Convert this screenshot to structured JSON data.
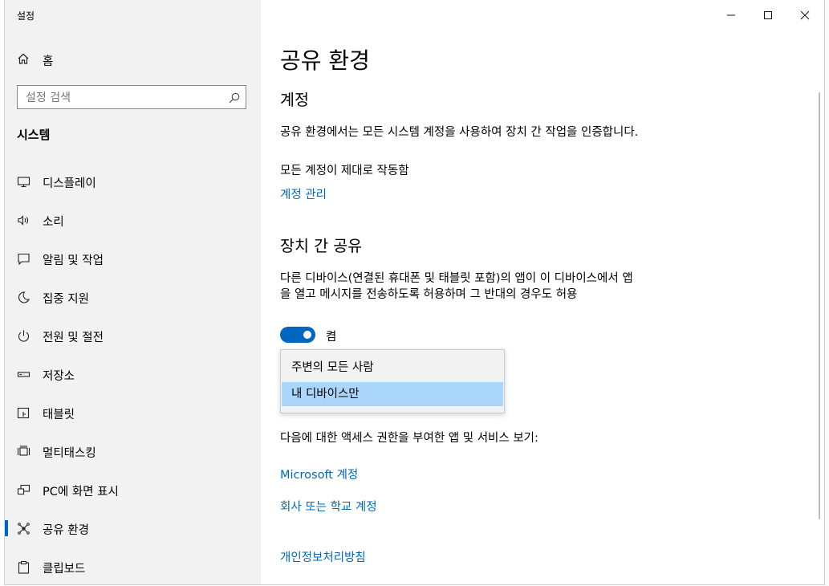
{
  "window": {
    "title": "설정",
    "controls": [
      "minimize",
      "maximize",
      "close"
    ]
  },
  "sidebar": {
    "home_label": "홈",
    "search_placeholder": "설정 검색",
    "section_title": "시스템",
    "items": [
      {
        "label": "디스플레이",
        "icon": "monitor-icon"
      },
      {
        "label": "소리",
        "icon": "speaker-icon"
      },
      {
        "label": "알림 및 작업",
        "icon": "notification-icon"
      },
      {
        "label": "집중 지원",
        "icon": "moon-icon"
      },
      {
        "label": "전원 및 절전",
        "icon": "power-icon"
      },
      {
        "label": "저장소",
        "icon": "storage-icon"
      },
      {
        "label": "태블릿",
        "icon": "tablet-icon"
      },
      {
        "label": "멀티태스킹",
        "icon": "multitasking-icon"
      },
      {
        "label": "PC에 화면 표시",
        "icon": "project-icon"
      },
      {
        "label": "공유 환경",
        "icon": "shared-experiences-icon",
        "active": true
      },
      {
        "label": "클립보드",
        "icon": "clipboard-icon"
      }
    ]
  },
  "main": {
    "page_title": "공유 환경",
    "accounts": {
      "heading": "계정",
      "description": "공유 환경에서는 모든 시스템 계정을 사용하여 장치 간 작업을 인증합니다.",
      "status": "모든 계정이 제대로 작동함",
      "manage_link": "계정 관리"
    },
    "share_across_devices": {
      "heading": "장치 간 공유",
      "description": "다른 디바이스(연결된 휴대폰 및 태블릿 포함)의 앱이 이 디바이스에서 앱을 열고 메시지를 전송하도록 허용하며 그 반대의 경우도 허용",
      "toggle_state": "켬",
      "toggle_on": true,
      "dropdown_options": [
        {
          "label": "주변의 모든 사람",
          "selected": false
        },
        {
          "label": "내 디바이스만",
          "selected": true
        }
      ]
    },
    "access_text": "다음에 대한 액세스 권한을 부여한 앱 및 서비스 보기:",
    "microsoft_account_link": "Microsoft 계정",
    "work_school_link": "회사 또는 학교 계정",
    "privacy_link": "개인정보처리방침"
  },
  "colors": {
    "accent": "#0067c0",
    "link": "#0067b8",
    "sidebar_bg": "#f2f2f2",
    "dropdown_selected": "#aad6fb"
  }
}
